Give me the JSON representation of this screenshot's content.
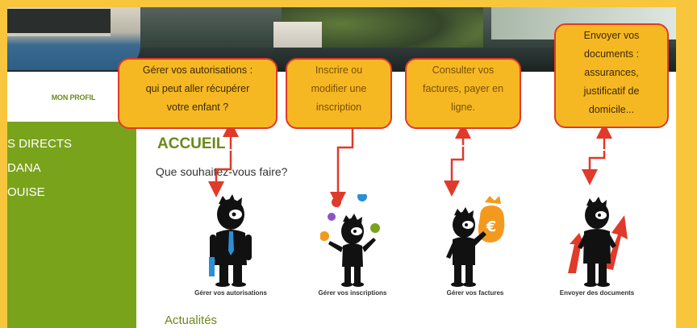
{
  "nav": {
    "profile_label": "MON PROFIL"
  },
  "sidebar": {
    "items": [
      {
        "label": "S DIRECTS"
      },
      {
        "label": "DANA"
      },
      {
        "label": "OUISE"
      }
    ]
  },
  "main": {
    "title": "ACCUEIL",
    "question": "Que souhaitez-vous faire?",
    "actions": [
      {
        "label": "Gérer vos autorisations",
        "icon": "man-with-tie-icon"
      },
      {
        "label": "Gérer vos inscriptions",
        "icon": "man-juggling-icon"
      },
      {
        "label": "Gérer vos factures",
        "icon": "man-money-bag-icon"
      },
      {
        "label": "Envoyer des documents",
        "icon": "man-arrows-icon"
      }
    ],
    "news_title": "Actualités"
  },
  "callouts": [
    {
      "lines": [
        "Gérer vos autorisations :",
        "qui peut aller récupérer",
        "votre enfant ?"
      ]
    },
    {
      "lines": [
        "Inscrire ou",
        "modifier une",
        "inscription"
      ]
    },
    {
      "lines": [
        "Consulter vos",
        "factures, payer en",
        "ligne."
      ]
    },
    {
      "lines": [
        "Envoyer vos",
        "documents :",
        "assurances,",
        "justificatif de",
        "domicile..."
      ]
    }
  ],
  "colors": {
    "frame": "#f7c63c",
    "brand_green": "#7aa31c",
    "callout_fill": "#f6b822",
    "callout_border": "#e03a2a",
    "arrow": "#e03a2a",
    "euro_bag": "#f39a1e"
  }
}
